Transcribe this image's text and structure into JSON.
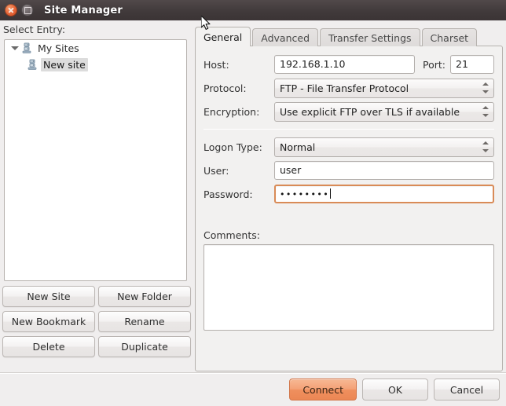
{
  "window": {
    "title": "Site Manager",
    "close_icon": "close-icon",
    "maximize_icon": "maximize-icon"
  },
  "left": {
    "select_entry_label": "Select Entry:",
    "tree": [
      {
        "label": "My Sites",
        "icon": "server-group-icon",
        "expanded": true,
        "selected": false,
        "level": 0,
        "arrow": "triangle-down-icon"
      },
      {
        "label": "New site",
        "icon": "server-icon",
        "expanded": false,
        "selected": true,
        "level": 1,
        "arrow": ""
      }
    ],
    "buttons": [
      {
        "label": "New Site",
        "name": "new-site-button"
      },
      {
        "label": "New Folder",
        "name": "new-folder-button"
      },
      {
        "label": "New Bookmark",
        "name": "new-bookmark-button"
      },
      {
        "label": "Rename",
        "name": "rename-button"
      },
      {
        "label": "Delete",
        "name": "delete-button"
      },
      {
        "label": "Duplicate",
        "name": "duplicate-button"
      }
    ]
  },
  "tabs": [
    {
      "label": "General",
      "active": true
    },
    {
      "label": "Advanced",
      "active": false
    },
    {
      "label": "Transfer Settings",
      "active": false
    },
    {
      "label": "Charset",
      "active": false
    }
  ],
  "general": {
    "host_label": "Host:",
    "host_value": "192.168.1.10",
    "port_label": "Port:",
    "port_value": "21",
    "protocol_label": "Protocol:",
    "protocol_value": "FTP - File Transfer Protocol",
    "encryption_label": "Encryption:",
    "encryption_value": "Use explicit FTP over TLS if available",
    "logon_type_label": "Logon Type:",
    "logon_type_value": "Normal",
    "user_label": "User:",
    "user_value": "user",
    "password_label": "Password:",
    "password_value": "••••••••",
    "comments_label": "Comments:",
    "comments_value": ""
  },
  "actions": [
    {
      "label": "Connect",
      "name": "connect-button",
      "primary": true
    },
    {
      "label": "OK",
      "name": "ok-button",
      "primary": false
    },
    {
      "label": "Cancel",
      "name": "cancel-button",
      "primary": false
    }
  ],
  "colors": {
    "accent": "#ef8f5e",
    "focus_border": "#d98b57",
    "titlebar": "#413a3b",
    "body_bg": "#f0eeee",
    "panel_bg": "#f2f1f0"
  }
}
